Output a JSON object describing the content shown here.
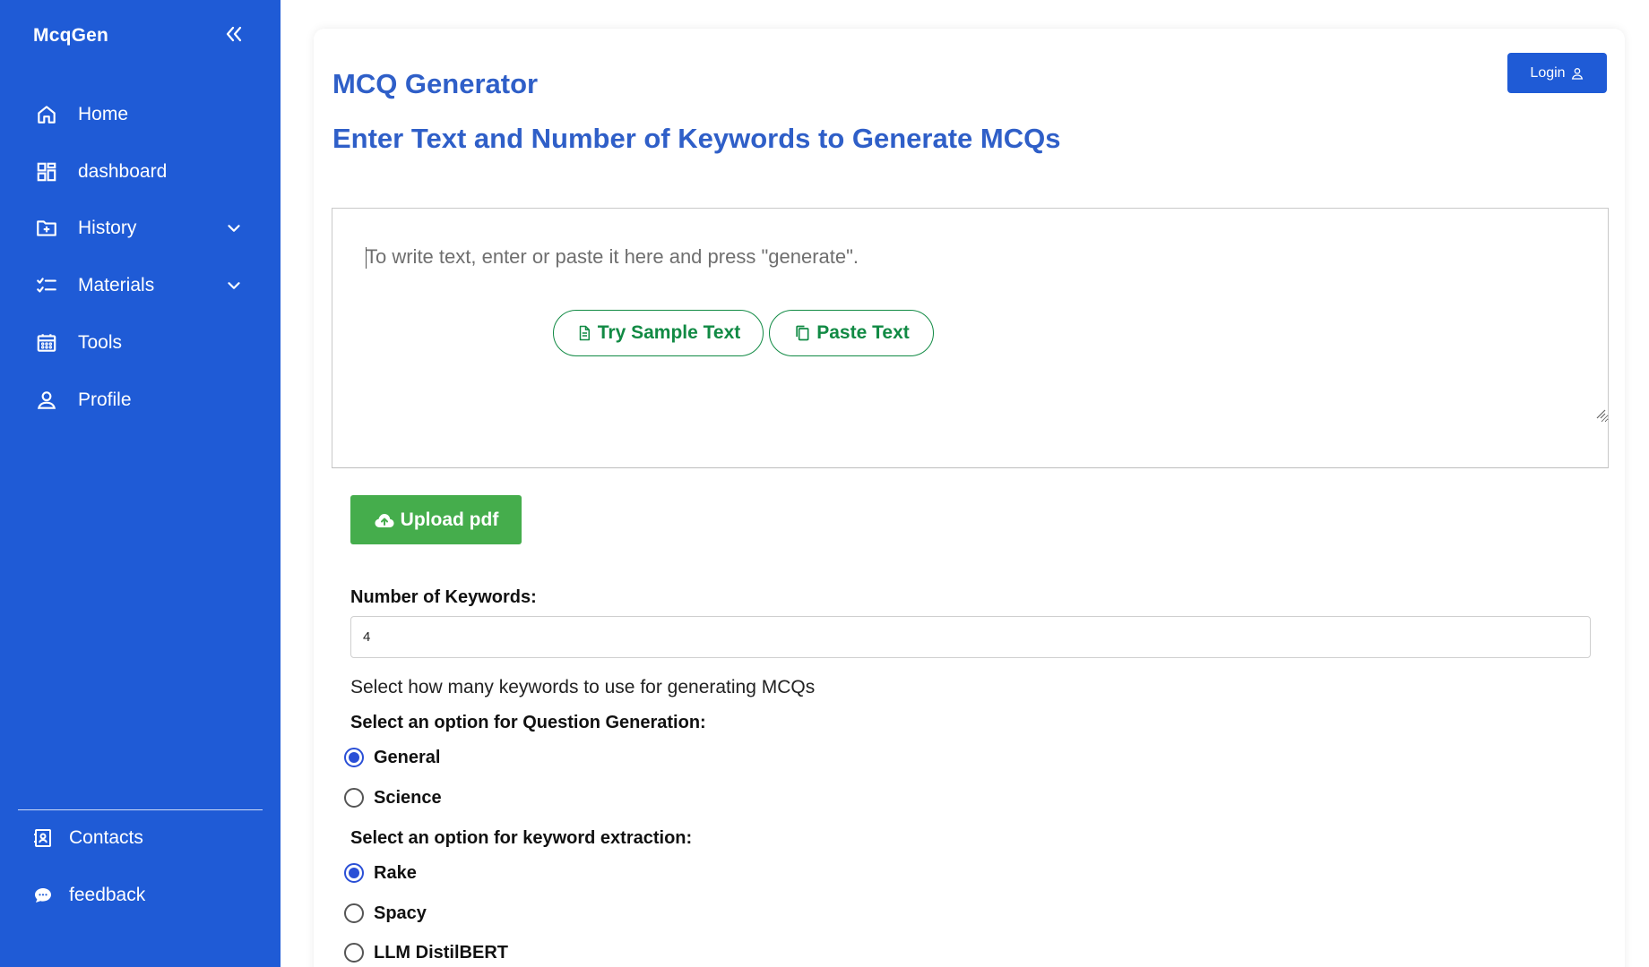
{
  "sidebar": {
    "brand": "McqGen",
    "items": [
      {
        "label": "Home",
        "icon": "home-icon"
      },
      {
        "label": "dashboard",
        "icon": "dashboard-icon"
      },
      {
        "label": "History",
        "icon": "folder-plus-icon",
        "has_submenu": true
      },
      {
        "label": "Materials",
        "icon": "checklist-icon",
        "has_submenu": true
      },
      {
        "label": "Tools",
        "icon": "calendar-icon"
      },
      {
        "label": "Profile",
        "icon": "user-icon"
      }
    ],
    "footer": [
      {
        "label": "Contacts",
        "icon": "contacts-icon"
      },
      {
        "label": "feedback",
        "icon": "chat-icon"
      }
    ]
  },
  "header": {
    "title": "MCQ Generator",
    "subtitle": "Enter Text and Number of Keywords to Generate MCQs",
    "login_label": "Login"
  },
  "editor": {
    "placeholder": "To write text, enter or paste it here and press \"generate\".",
    "sample_label": "Try Sample Text",
    "paste_label": "Paste Text"
  },
  "upload": {
    "label": "Upload pdf"
  },
  "keywords": {
    "label": "Number of Keywords:",
    "value": "4",
    "helper": "Select how many keywords to use for generating MCQs"
  },
  "question_generation": {
    "label": "Select an option for Question Generation:",
    "options": [
      "General",
      "Science"
    ],
    "selected": "General"
  },
  "keyword_extraction": {
    "label": "Select an option for keyword extraction:",
    "options": [
      "Rake",
      "Spacy",
      "LLM DistilBERT"
    ],
    "selected": "Rake"
  },
  "colors": {
    "sidebar_bg": "#1f5bd6",
    "accent": "#2f5fc8",
    "success": "#45ad4c",
    "outline_green": "#118a44"
  }
}
